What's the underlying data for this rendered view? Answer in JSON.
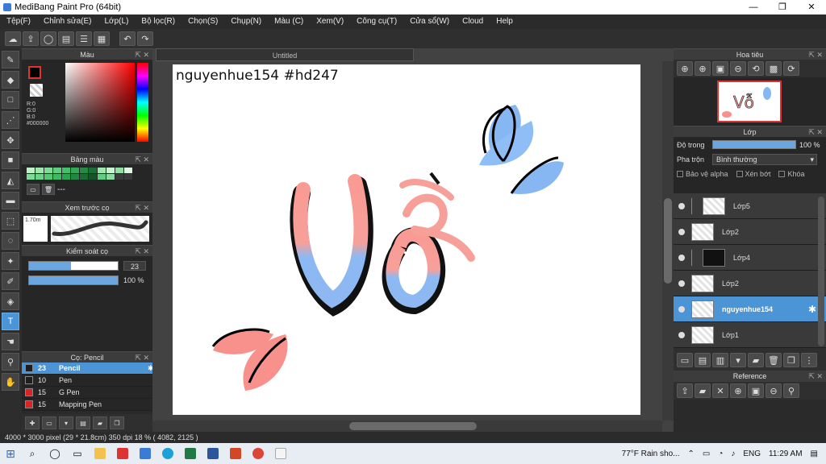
{
  "window": {
    "title": "MediBang Paint Pro (64bit)",
    "minimize": "—",
    "maximize": "❐",
    "close": "✕"
  },
  "menu": [
    "Tệp(F)",
    "Chỉnh sửa(E)",
    "Lớp(L)",
    "Bộ lọc(R)",
    "Chọn(S)",
    "Chụp(N)",
    "Màu (C)",
    "Xem(V)",
    "Công cụ(T)",
    "Cửa sổ(W)",
    "Cloud",
    "Help"
  ],
  "toolbar": {
    "undo": "↶",
    "redo": "↷"
  },
  "panels": {
    "color": {
      "title": "Màu",
      "r": "R:0",
      "g": "G:0",
      "b": "B:0",
      "hex": "#000000"
    },
    "palette": {
      "title": "Bảng màu",
      "value": "---"
    },
    "brushPreview": {
      "title": "Xem trước cọ",
      "size": "1.70m"
    },
    "brushControl": {
      "title": "Kiểm soát cọ",
      "size": "23",
      "opacity": "100 %",
      "size_level": 0.47,
      "opacity_level": 1.0
    },
    "brushList": {
      "title": "Cọ: Pencil",
      "items": [
        {
          "num": "23",
          "name": "Pencil",
          "color": "#1e1e1e"
        },
        {
          "num": "10",
          "name": "Pen",
          "color": "#1e1e1e"
        },
        {
          "num": "15",
          "name": "G Pen",
          "color": "#d22"
        },
        {
          "num": "15",
          "name": "Mapping Pen",
          "color": "#d22"
        }
      ]
    }
  },
  "canvas": {
    "tab": "Untitled",
    "text": "nguyenhue154  #hd247"
  },
  "navigator": {
    "title": "Hoa tiêu"
  },
  "layer": {
    "title": "Lớp",
    "opacity_label": "Độ trong",
    "opacity_value": "100 %",
    "blend_label": "Pha trộn",
    "blend_value": "Bình thường",
    "check_alpha": "Bảo vệ alpha",
    "check_clip": "Xén bớt",
    "check_lock": "Khóa",
    "items": [
      {
        "name": "Lớp5",
        "indent": true,
        "selected": false
      },
      {
        "name": "Lớp2",
        "indent": false,
        "selected": false
      },
      {
        "name": "Lớp4",
        "indent": true,
        "selected": false
      },
      {
        "name": "Lớp2",
        "indent": false,
        "selected": false
      },
      {
        "name": "nguyenhue154",
        "indent": false,
        "selected": true
      },
      {
        "name": "Lớp1",
        "indent": false,
        "selected": false
      }
    ]
  },
  "reference": {
    "title": "Reference"
  },
  "status": {
    "text": "4000 * 3000 pixel   (29 * 21.8cm)   350 dpi   18 %   ( 4082, 2125 )"
  },
  "taskbar": {
    "weather": "77°F  Rain sho...",
    "lang": "ENG",
    "time": "11:29 AM"
  }
}
